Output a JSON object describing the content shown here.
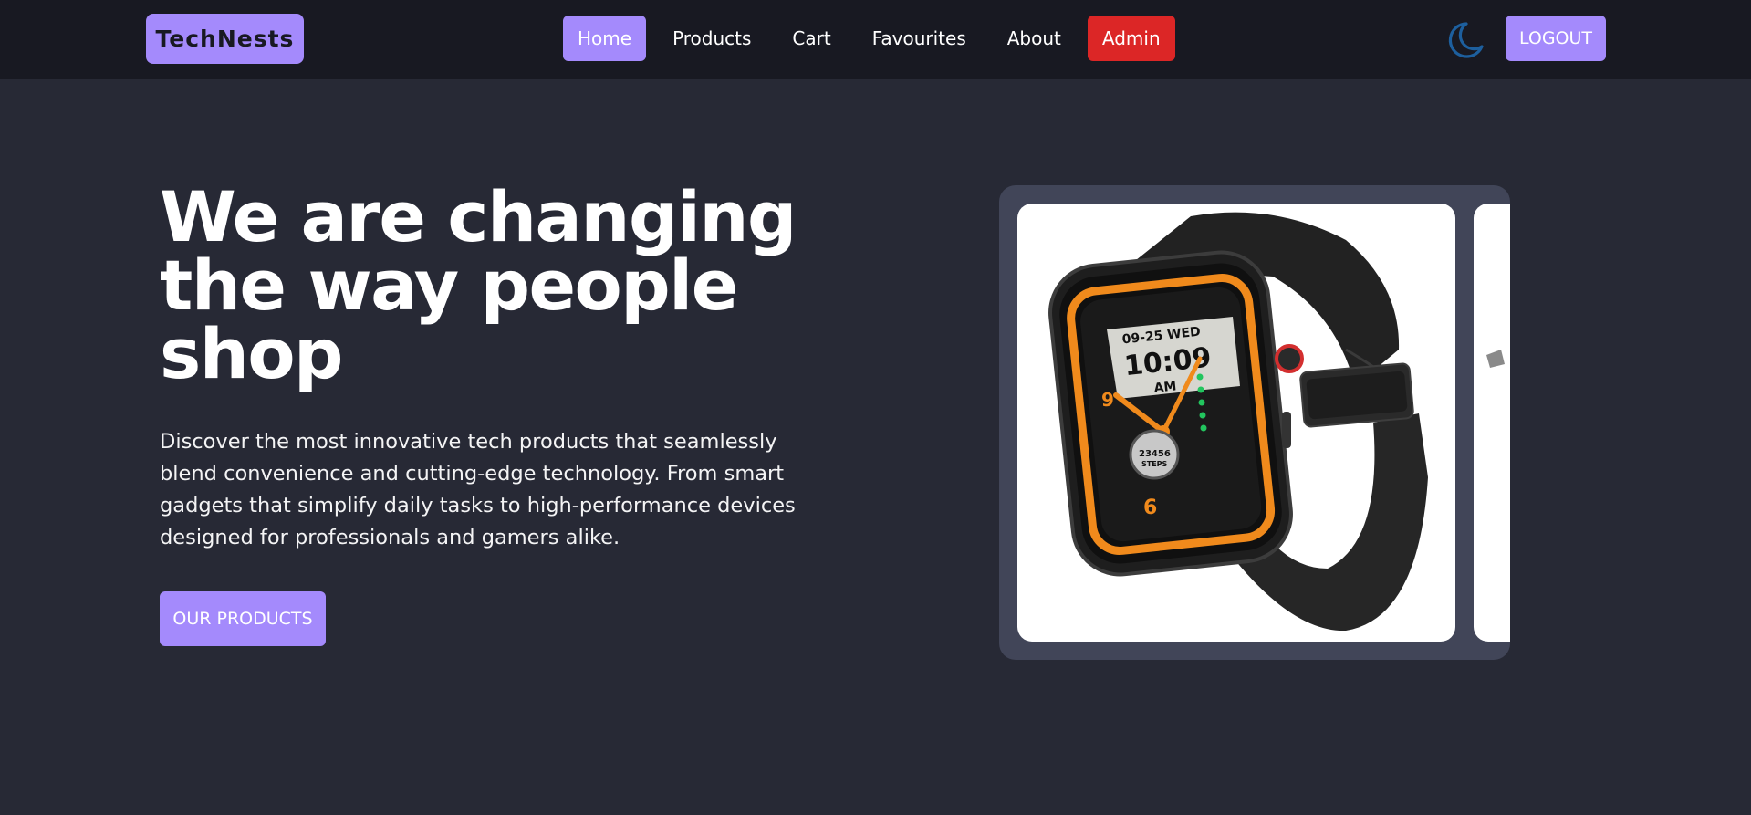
{
  "navbar": {
    "brand": "TechNests",
    "links": [
      {
        "label": "Home",
        "state": "active"
      },
      {
        "label": "Products"
      },
      {
        "label": "Cart"
      },
      {
        "label": "Favourites"
      },
      {
        "label": "About"
      },
      {
        "label": "Admin",
        "state": "danger"
      }
    ],
    "theme_icon": "moon-icon",
    "logout_label": "LOGOUT"
  },
  "hero": {
    "title": "We are changing the way people shop",
    "description": "Discover the most innovative tech products that seamlessly blend convenience and cutting-edge technology. From smart gadgets that simplify daily tasks to high-performance devices designed for professionals and gamers alike.",
    "cta_label": "OUR PRODUCTS"
  },
  "carousel": {
    "slides": [
      {
        "image": "smartwatch-image",
        "watch_face": {
          "date": "09-25 WED",
          "time": "10:09",
          "ampm": "AM",
          "steps": "23456",
          "steps_label": "STEPS",
          "num_left": "9",
          "num_bottom": "6"
        }
      },
      {
        "image": "product-image"
      }
    ]
  },
  "colors": {
    "page_bg": "#272935",
    "nav_bg": "#181922",
    "accent": "#a48afc",
    "danger": "#dc2626",
    "carousel_bg": "#414558",
    "moon": "#1d5f9e",
    "watch_orange": "#f08a1c"
  }
}
